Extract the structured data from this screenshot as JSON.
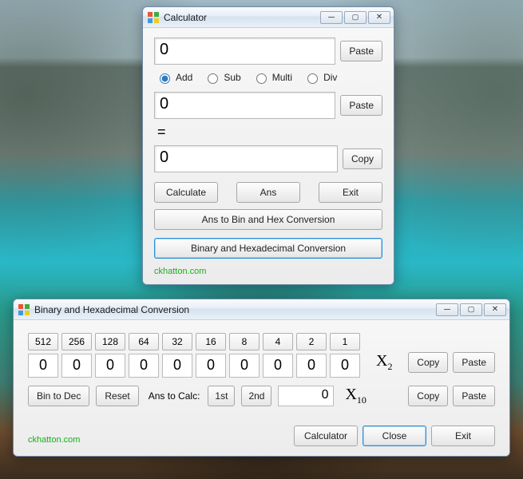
{
  "calc": {
    "title": "Calculator",
    "input1": "0",
    "input2": "0",
    "result": "0",
    "equals": "=",
    "ops": {
      "add": "Add",
      "sub": "Sub",
      "multi": "Multi",
      "div": "Div"
    },
    "buttons": {
      "paste": "Paste",
      "copy": "Copy",
      "calculate": "Calculate",
      "ans": "Ans",
      "exit": "Exit",
      "ans_to_binhex": "Ans to Bin and Hex Conversion",
      "binhex_window": "Binary and Hexadecimal Conversion"
    },
    "footer": "ckhatton.com"
  },
  "binhex": {
    "title": "Binary and Hexadecimal Conversion",
    "bit_headers": [
      "512",
      "256",
      "128",
      "64",
      "32",
      "16",
      "8",
      "4",
      "2",
      "1"
    ],
    "bit_values": [
      "0",
      "0",
      "0",
      "0",
      "0",
      "0",
      "0",
      "0",
      "0",
      "0"
    ],
    "x2": "X",
    "x2_sub": "2",
    "x10": "X",
    "x10_sub": "10",
    "dec_value": "0",
    "buttons": {
      "copy": "Copy",
      "paste": "Paste",
      "bin_to_dec": "Bin to Dec",
      "reset": "Reset",
      "ans_to_calc": "Ans to Calc:",
      "first": "1st",
      "second": "2nd",
      "calculator": "Calculator",
      "close": "Close",
      "exit": "Exit"
    },
    "footer": "ckhatton.com"
  }
}
